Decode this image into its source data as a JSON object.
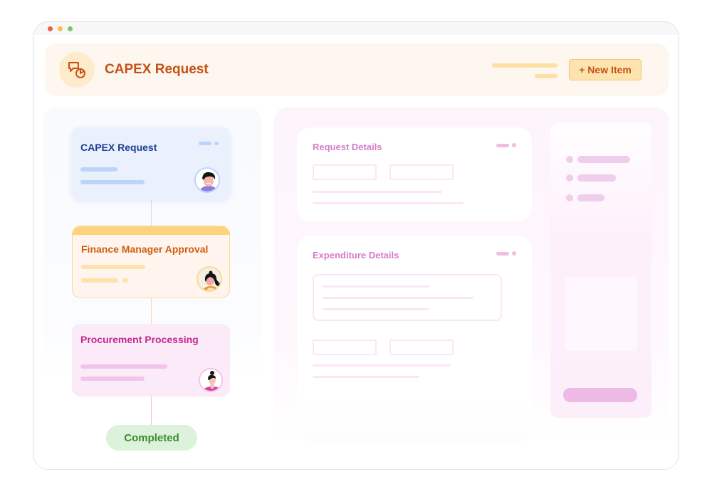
{
  "window": {
    "traffic_lights": [
      "close",
      "minimize",
      "maximize"
    ]
  },
  "header": {
    "icon": "chat-pie-chart-icon",
    "title": "CAPEX Request",
    "new_item_button": "+ New Item"
  },
  "workflow": {
    "steps": [
      {
        "title": "CAPEX Request",
        "theme": "blue",
        "avatar": "man-avatar"
      },
      {
        "title": "Finance Manager Approval",
        "theme": "orange",
        "avatar": "woman-avatar"
      },
      {
        "title": "Procurement Processing",
        "theme": "pink",
        "avatar": "woman-bun-avatar"
      }
    ],
    "end_state": "Completed"
  },
  "form": {
    "sections": [
      {
        "title": "Request Details"
      },
      {
        "title": "Expenditure Details"
      }
    ]
  },
  "colors": {
    "accent_orange": "#c65113",
    "blue_title": "#1c3f94",
    "orange_title": "#cd5d10",
    "pink_title": "#c1288f",
    "section_title": "#d57bc9",
    "completed_green": "#3c8a30"
  }
}
